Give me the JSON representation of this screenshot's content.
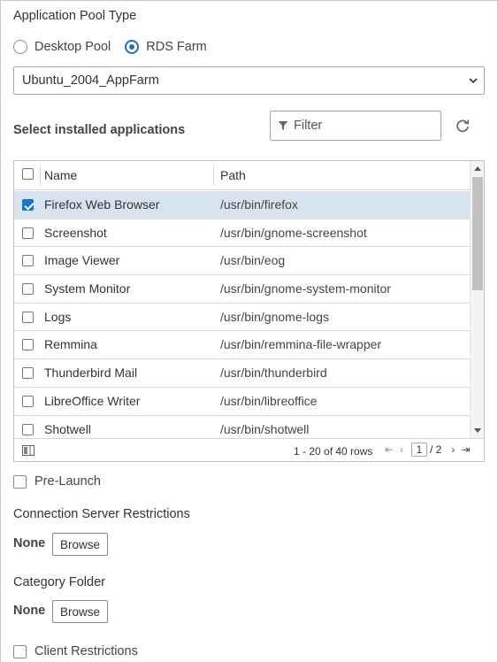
{
  "pool_type": {
    "title": "Application Pool Type",
    "options": [
      {
        "label": "Desktop Pool",
        "selected": false
      },
      {
        "label": "RDS Farm",
        "selected": true
      }
    ]
  },
  "farm_select": {
    "value": "Ubuntu_2004_AppFarm"
  },
  "apps": {
    "title": "Select installed applications",
    "filter_placeholder": "Filter",
    "columns": {
      "name": "Name",
      "path": "Path"
    },
    "rows": [
      {
        "name": "Firefox Web Browser",
        "path": "/usr/bin/firefox",
        "checked": true
      },
      {
        "name": "Screenshot",
        "path": "/usr/bin/gnome-screenshot",
        "checked": false
      },
      {
        "name": "Image Viewer",
        "path": "/usr/bin/eog",
        "checked": false
      },
      {
        "name": "System Monitor",
        "path": "/usr/bin/gnome-system-monitor",
        "checked": false
      },
      {
        "name": "Logs",
        "path": "/usr/bin/gnome-logs",
        "checked": false
      },
      {
        "name": "Remmina",
        "path": "/usr/bin/remmina-file-wrapper",
        "checked": false
      },
      {
        "name": "Thunderbird Mail",
        "path": "/usr/bin/thunderbird",
        "checked": false
      },
      {
        "name": "LibreOffice Writer",
        "path": "/usr/bin/libreoffice",
        "checked": false
      },
      {
        "name": "Shotwell",
        "path": "/usr/bin/shotwell",
        "checked": false
      }
    ],
    "footer": {
      "rows_info": "1 - 20 of 40 rows",
      "page": "1",
      "total_pages": "/ 2"
    }
  },
  "pre_launch": {
    "label": "Pre-Launch",
    "checked": false
  },
  "connection_server": {
    "title": "Connection Server Restrictions",
    "value": "None",
    "browse_label": "Browse"
  },
  "category_folder": {
    "title": "Category Folder",
    "value": "None",
    "browse_label": "Browse"
  },
  "client_restrictions": {
    "label": "Client Restrictions",
    "checked": false
  },
  "icons": {
    "dropdown": "chevron-down-icon",
    "filter": "filter-icon",
    "refresh": "refresh-icon",
    "columns": "column-toggle-icon",
    "pager": [
      "first-page-icon",
      "prev-page-icon",
      "next-page-icon",
      "last-page-icon"
    ]
  },
  "colors": {
    "accent": "#1d6fc4",
    "selected_row": "#d7e4ef"
  }
}
